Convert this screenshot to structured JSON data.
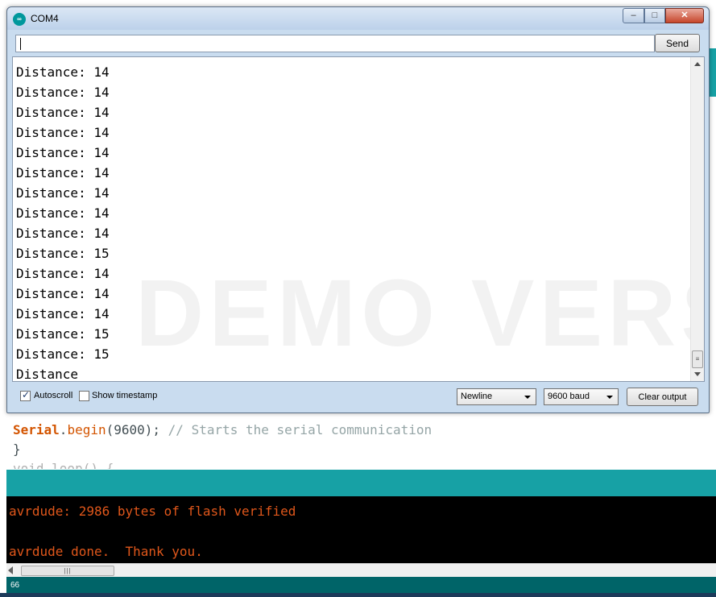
{
  "window": {
    "title": "COM4",
    "icon": "arduino-infinity-icon",
    "controls": {
      "minimize": "–",
      "maximize": "□",
      "close": "✕"
    }
  },
  "input": {
    "value": "",
    "send_label": "Send"
  },
  "output": {
    "lines": [
      "Distance: 14",
      "Distance: 14",
      "Distance: 14",
      "Distance: 14",
      "Distance: 14",
      "Distance: 14",
      "Distance: 14",
      "Distance: 14",
      "Distance: 14",
      "Distance: 15",
      "Distance: 14",
      "Distance: 14",
      "Distance: 14",
      "Distance: 15",
      "Distance: 15",
      "Distance"
    ],
    "watermark": "DEMO VERSION"
  },
  "options": {
    "autoscroll_label": "Autoscroll",
    "autoscroll_checked": true,
    "timestamp_label": "Show timestamp",
    "timestamp_checked": false,
    "line_ending": "Newline",
    "baud_rate": "9600 baud",
    "clear_label": "Clear output"
  },
  "ide": {
    "code": {
      "obj": "Serial",
      "dot": ".",
      "method": "begin",
      "args": "(9600); ",
      "comment": "// Starts the serial communication",
      "brace": "}",
      "partial": "void loop() {"
    },
    "console": {
      "line1": "avrdude: 2986 bytes of flash verified",
      "line2": "avrdude done.  Thank you."
    },
    "line_number": "66"
  },
  "colors": {
    "teal": "#17a1a5",
    "dark_teal": "#006468",
    "console_text": "#e0571b",
    "keyword": "#d35400"
  }
}
